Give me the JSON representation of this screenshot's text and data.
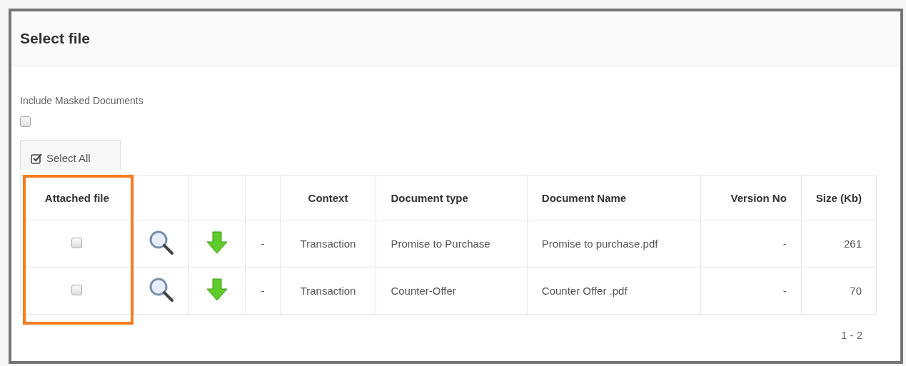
{
  "dialog": {
    "title": "Select file"
  },
  "mask_option": {
    "label": "Include Masked Documents",
    "checked": false
  },
  "select_all_button": {
    "label": "Select All"
  },
  "table": {
    "columns": [
      "Attached file",
      "",
      "",
      "",
      "Context",
      "Document type",
      "Document Name",
      "Version No",
      "Size (Kb)"
    ],
    "rows": [
      {
        "checked": false,
        "column_4": "-",
        "context": "Transaction",
        "document_type": "Promise to Purchase",
        "document_name": "Promise to purchase.pdf",
        "version_no": "-",
        "size": "261"
      },
      {
        "checked": false,
        "column_4": "-",
        "context": "Transaction",
        "document_type": "Counter-Offer",
        "document_name": "Counter Offer .pdf",
        "version_no": "-",
        "size": "70"
      }
    ]
  },
  "highlight": {
    "color": "#f57c20"
  },
  "pager": {
    "range": "1 - 2"
  }
}
